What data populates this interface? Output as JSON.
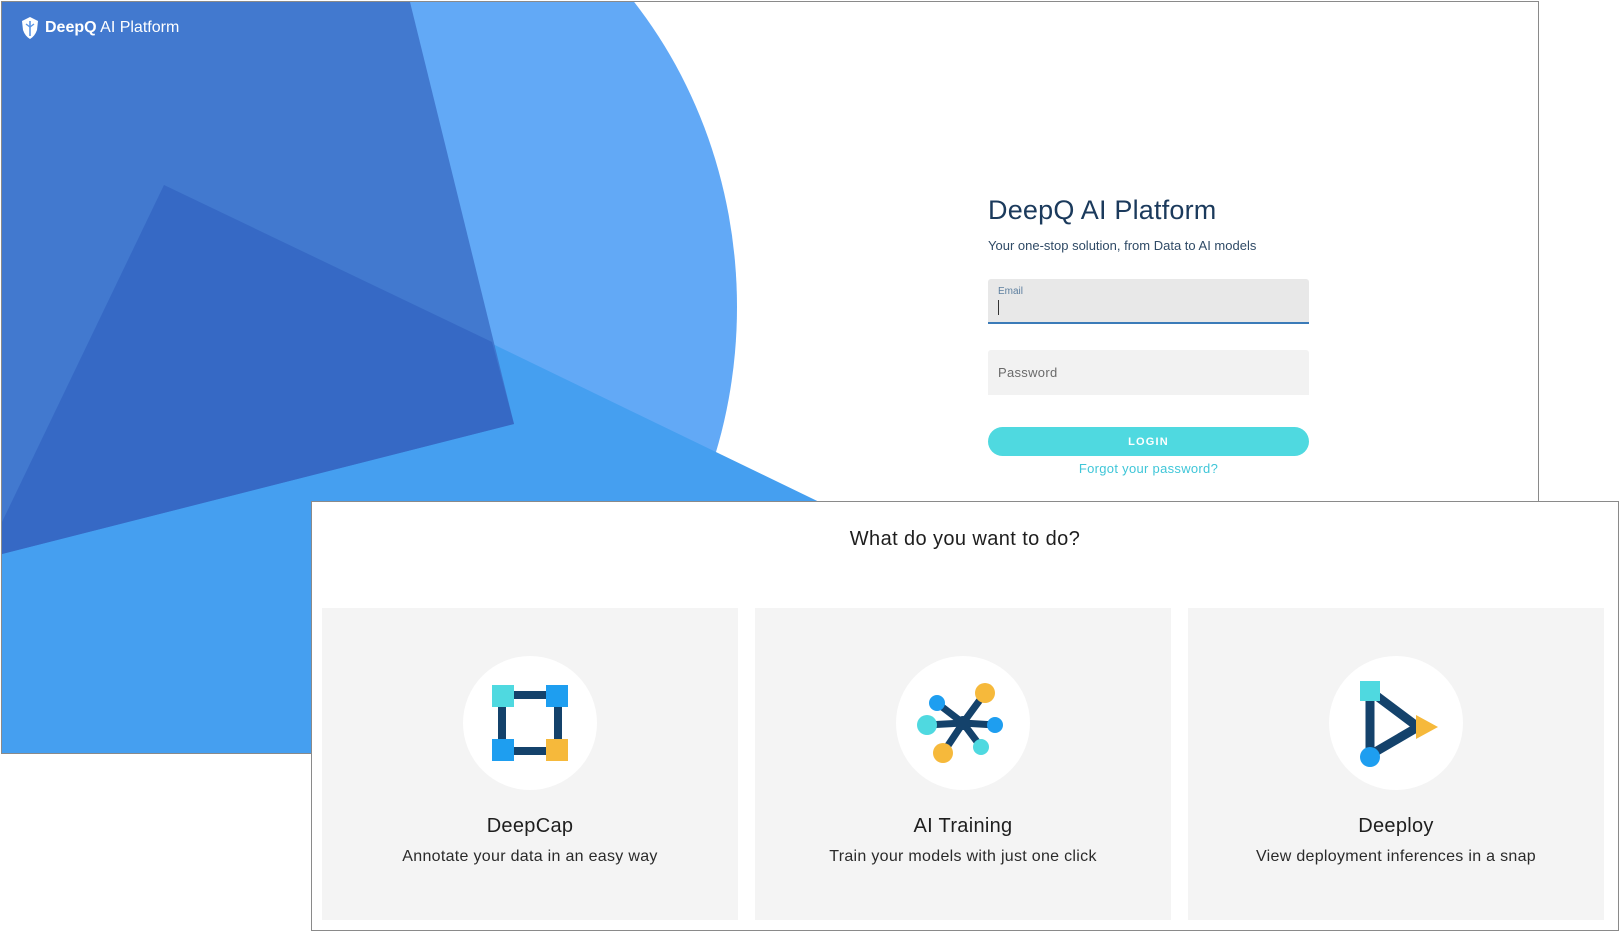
{
  "brand": {
    "name_bold": "DeepQ",
    "name_light": "AI Platform"
  },
  "login": {
    "title": "DeepQ AI Platform",
    "subtitle": "Your one-stop solution, from Data to AI models",
    "email_label": "Email",
    "email_value": "",
    "password_placeholder": "Password",
    "login_label": "LOGIN",
    "forgot_label": "Forgot your password?"
  },
  "chooser": {
    "title": "What do you want to do?",
    "cards": [
      {
        "title": "DeepCap",
        "description": "Annotate your data in an easy way",
        "icon": "annotation-icon"
      },
      {
        "title": "AI Training",
        "description": "Train your models with just one click",
        "icon": "network-icon"
      },
      {
        "title": "Deeploy",
        "description": "View deployment inferences in a snap",
        "icon": "deploy-play-icon"
      }
    ]
  },
  "colors": {
    "accent": "#4fd9e0",
    "link": "#3fc6d8",
    "title_navy": "#1b3a5c",
    "hero_blue": "#459ff0",
    "icon_navy": "#14426b",
    "icon_cyan": "#4fd9e0",
    "icon_blue": "#1e9ef0",
    "icon_yellow": "#f6b93b"
  }
}
